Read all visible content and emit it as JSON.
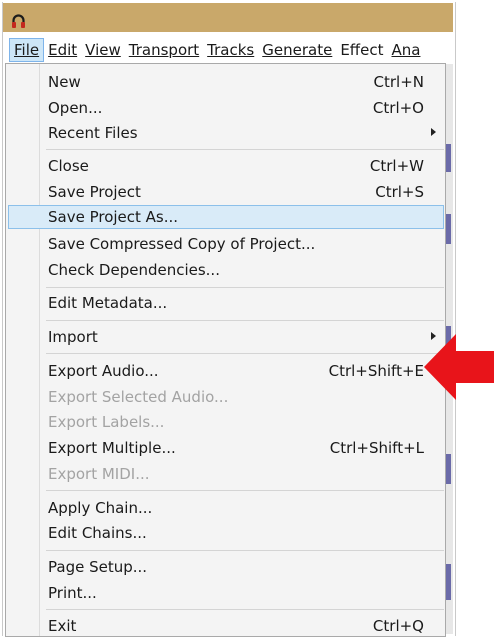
{
  "colors": {
    "titlebar": "#c9a86a",
    "highlight": "#d9ebf8",
    "arrow": "#e8141a",
    "disabled_text": "#a3a3a3"
  },
  "app_icon": "headphones-icon",
  "menubar": {
    "items": [
      {
        "label": "File",
        "active": true
      },
      {
        "label": "Edit"
      },
      {
        "label": "View"
      },
      {
        "label": "Transport"
      },
      {
        "label": "Tracks"
      },
      {
        "label": "Generate"
      },
      {
        "label": "Effect"
      },
      {
        "label": "Ana"
      }
    ]
  },
  "file_menu": {
    "items": [
      {
        "label": "New",
        "shortcut": "Ctrl+N"
      },
      {
        "label": "Open...",
        "shortcut": "Ctrl+O"
      },
      {
        "label": "Recent Files",
        "submenu": true
      },
      {
        "label": "Close",
        "shortcut": "Ctrl+W"
      },
      {
        "label": "Save Project",
        "shortcut": "Ctrl+S"
      },
      {
        "label": "Save Project As...",
        "highlighted": true
      },
      {
        "label": "Save Compressed Copy of Project..."
      },
      {
        "label": "Check Dependencies..."
      },
      {
        "label": "Edit Metadata..."
      },
      {
        "label": "Import",
        "submenu": true
      },
      {
        "label": "Export Audio...",
        "shortcut": "Ctrl+Shift+E"
      },
      {
        "label": "Export Selected Audio...",
        "disabled": true
      },
      {
        "label": "Export Labels...",
        "disabled": true
      },
      {
        "label": "Export Multiple...",
        "shortcut": "Ctrl+Shift+L"
      },
      {
        "label": "Export MIDI...",
        "disabled": true
      },
      {
        "label": "Apply Chain..."
      },
      {
        "label": "Edit Chains..."
      },
      {
        "label": "Page Setup..."
      },
      {
        "label": "Print..."
      },
      {
        "label": "Exit",
        "shortcut": "Ctrl+Q"
      }
    ]
  },
  "annotation": {
    "icon": "red-arrow-icon",
    "points_to": "Export Audio..."
  }
}
